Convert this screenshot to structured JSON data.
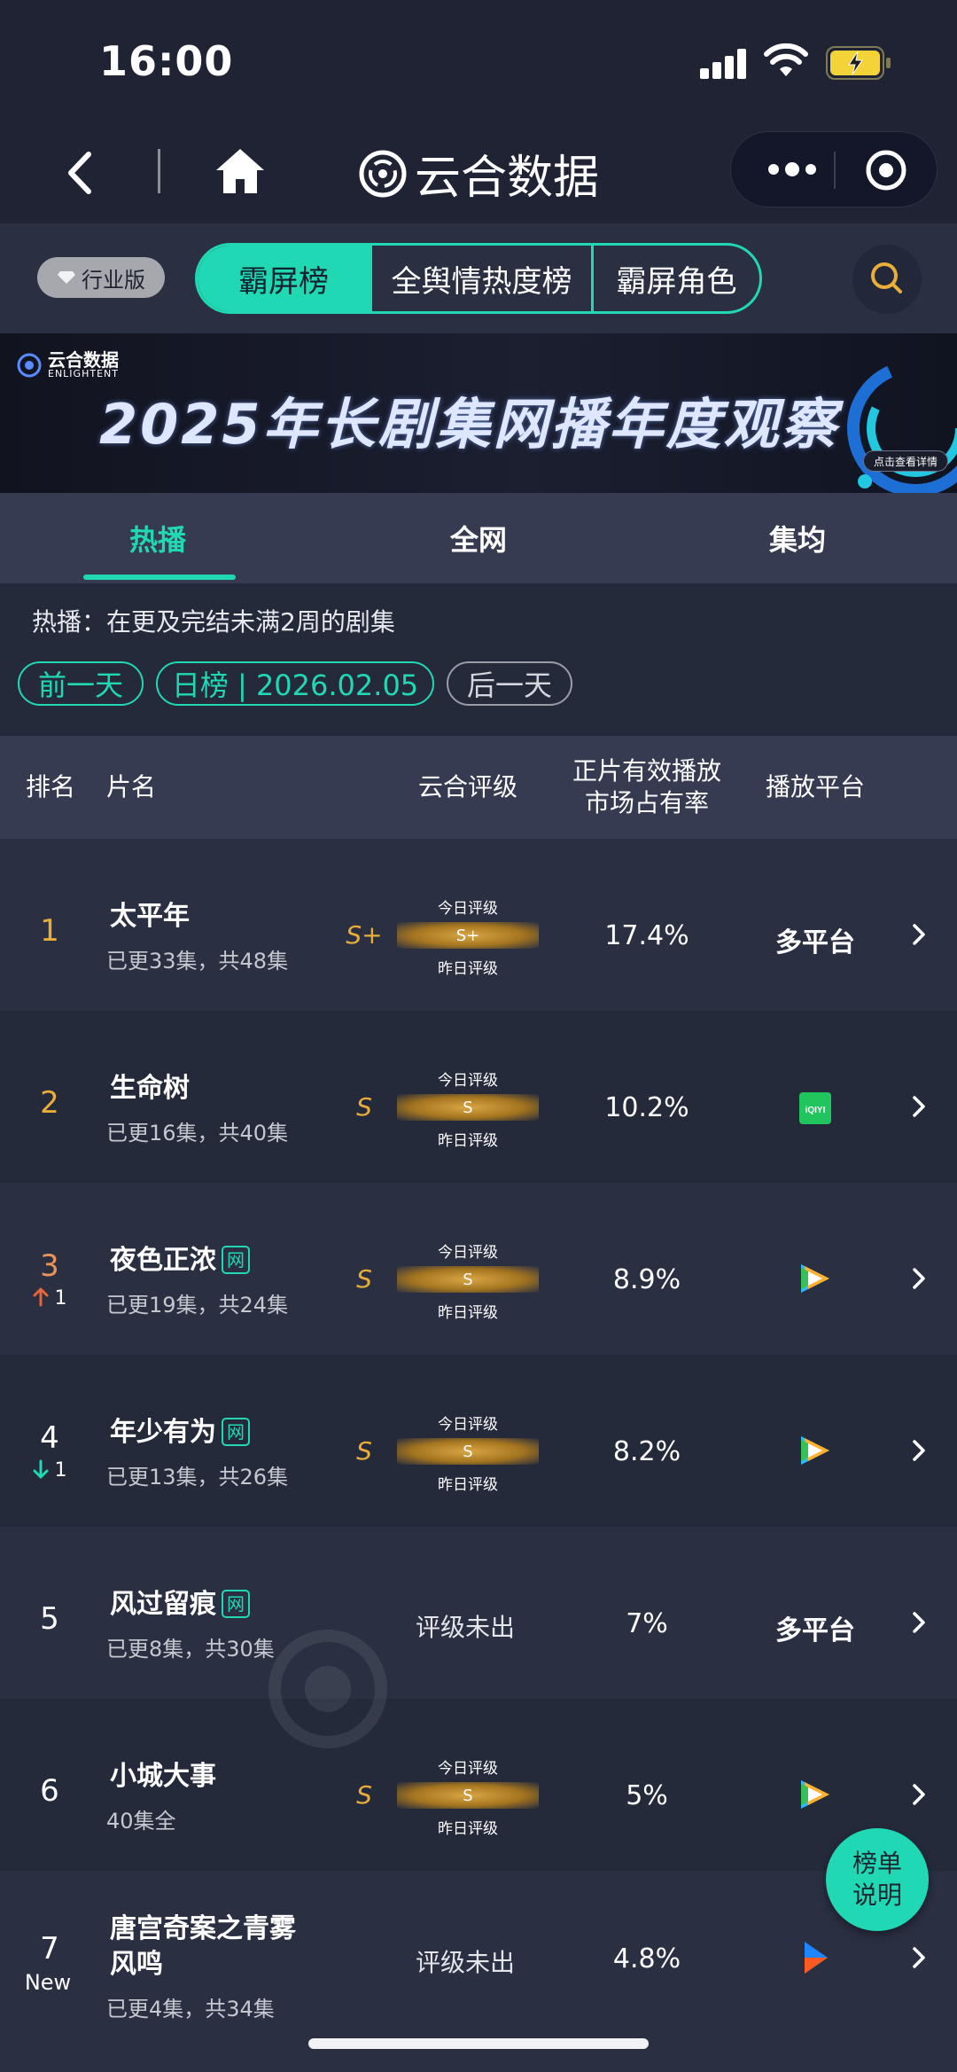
{
  "status_bar": {
    "time": "16:00"
  },
  "nav": {
    "title": "云合数据"
  },
  "top_tabs": {
    "edition": "行业版",
    "items": [
      {
        "label": "霸屏榜",
        "active": true
      },
      {
        "label": "全舆情热度榜",
        "active": false
      },
      {
        "label": "霸屏角色",
        "active": false
      }
    ]
  },
  "banner": {
    "logo_cn": "云合数据",
    "logo_en": "ENLIGHTENT",
    "title": "2025年长剧集网播年度观察",
    "cta": "点击查看详情"
  },
  "sub_tabs": [
    {
      "label": "热播",
      "active": true
    },
    {
      "label": "全网",
      "active": false
    },
    {
      "label": "集均",
      "active": false
    }
  ],
  "description": "热播：在更及完结未满2周的剧集",
  "date_nav": {
    "prev": "前一天",
    "current": "日榜 | 2026.02.05",
    "next": "后一天"
  },
  "table_header": {
    "rank": "排名",
    "name": "片名",
    "grade": "云合评级",
    "share_line1": "正片有效播放",
    "share_line2": "市场占有率",
    "platform": "播放平台"
  },
  "grade_labels": {
    "today": "今日评级",
    "yesterday": "昨日评级",
    "none": "评级未出"
  },
  "rows": [
    {
      "rank": "1",
      "change": "",
      "title": "太平年",
      "net": "",
      "sub": "已更33集，共48集",
      "grade": "S+",
      "grade_bar": "S+",
      "share": "17.4%",
      "platform": "多平台",
      "platform_icon": ""
    },
    {
      "rank": "2",
      "change": "",
      "title": "生命树",
      "net": "",
      "sub": "已更16集，共40集",
      "grade": "S",
      "grade_bar": "S",
      "share": "10.2%",
      "platform": "",
      "platform_icon": "iqiyi-icon"
    },
    {
      "rank": "3",
      "change": "1",
      "title": "夜色正浓",
      "net": "网",
      "sub": "已更19集，共24集",
      "grade": "S",
      "grade_bar": "S",
      "share": "8.9%",
      "platform": "",
      "platform_icon": "tencent-video-icon"
    },
    {
      "rank": "4",
      "change": "1",
      "title": "年少有为",
      "net": "网",
      "sub": "已更13集，共26集",
      "grade": "S",
      "grade_bar": "S",
      "share": "8.2%",
      "platform": "",
      "platform_icon": "tencent-video-icon"
    },
    {
      "rank": "5",
      "change": "",
      "title": "风过留痕",
      "net": "网",
      "sub": "已更8集，共30集",
      "grade": "",
      "grade_bar": "",
      "share": "7%",
      "platform": "多平台",
      "platform_icon": ""
    },
    {
      "rank": "6",
      "change": "",
      "title": "小城大事",
      "net": "",
      "sub": "40集全",
      "grade": "S",
      "grade_bar": "S",
      "share": "5%",
      "platform": "",
      "platform_icon": "tencent-video-icon"
    },
    {
      "rank": "7",
      "change": "New",
      "title_line1": "唐宫奇案之青雾",
      "title_line2": "风鸣",
      "net": "",
      "sub": "已更4集，共34集",
      "grade": "",
      "grade_bar": "",
      "share": "4.8%",
      "platform": "",
      "platform_icon": "youku-icon"
    }
  ],
  "help_button": {
    "line1": "榜单",
    "line2": "说明"
  },
  "colors": {
    "accent": "#20d8b4",
    "gold": "#e9ad3a",
    "up": "#e8643a",
    "down": "#20d8b4"
  }
}
